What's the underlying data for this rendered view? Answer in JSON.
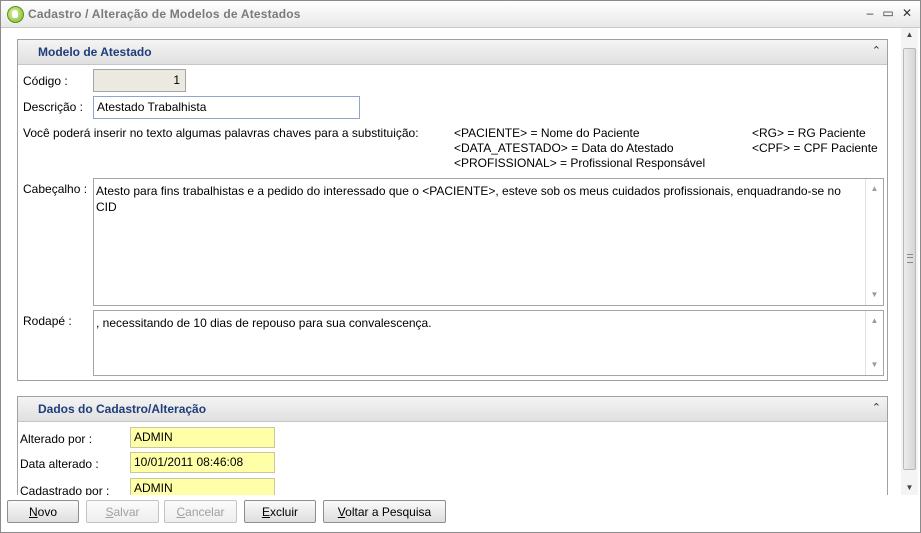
{
  "window": {
    "title": "Cadastro / Alteração de Modelos de Atestados",
    "controls": {
      "minimize": "–",
      "restore": "▭",
      "close": "✕"
    }
  },
  "modelo": {
    "section_title": "Modelo de Atestado",
    "codigo_label": "Código :",
    "codigo_value": "1",
    "descricao_label": "Descrição :",
    "descricao_value": "Atestado Trabalhista",
    "instrucao": "Você poderá inserir no texto algumas palavras chaves para a substituição:",
    "keywords": [
      "<PACIENTE> = Nome do Paciente",
      "<DATA_ATESTADO> = Data do Atestado",
      "<PROFISSIONAL> = Profissional Responsável",
      "<RG> = RG Paciente",
      "<CPF> = CPF Paciente"
    ],
    "cabecalho_label": "Cabeçalho :",
    "cabecalho_value": "Atesto para fins trabalhistas e a pedido do interessado que o <PACIENTE>, esteve sob os meus cuidados profissionais, enquadrando-se no CID",
    "rodape_label": "Rodapé :",
    "rodape_value": ", necessitando de 10 dias de repouso para sua convalescença."
  },
  "dados": {
    "section_title": "Dados do Cadastro/Alteração",
    "alterado_por_label": "Alterado por :",
    "alterado_por_value": "ADMIN",
    "data_alterado_label": "Data alterado :",
    "data_alterado_value": "10/01/2011 08:46:08",
    "cadastrado_por_label": "Cadastrado por :",
    "cadastrado_por_value": "ADMIN"
  },
  "buttons": {
    "novo": {
      "first": "N",
      "rest": "ovo"
    },
    "salvar": {
      "first": "S",
      "rest": "alvar"
    },
    "cancelar": {
      "first": "C",
      "rest": "ancelar"
    },
    "excluir": {
      "first": "E",
      "rest": "xcluir"
    },
    "voltar": {
      "first": "V",
      "rest": "oltar a Pesquisa"
    }
  }
}
